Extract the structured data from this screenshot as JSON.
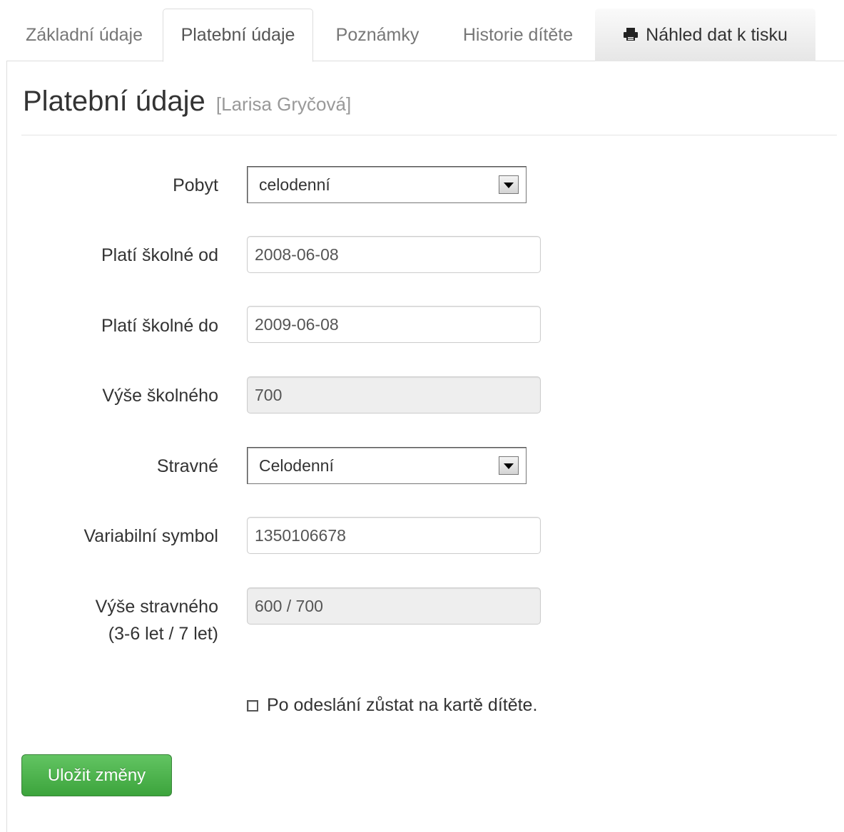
{
  "tabs": [
    {
      "label": "Základní údaje",
      "active": false
    },
    {
      "label": "Platební údaje",
      "active": true
    },
    {
      "label": "Poznámky",
      "active": false
    },
    {
      "label": "Historie dítěte",
      "active": false
    },
    {
      "label": "Náhled dat k tisku",
      "active": false,
      "icon": "printer-icon"
    }
  ],
  "page": {
    "title": "Platební údaje",
    "subtitle": "[Larisa Gryčová]"
  },
  "form": {
    "pobyt": {
      "label": "Pobyt",
      "value": "celodenní"
    },
    "plati_od": {
      "label": "Platí školné od",
      "value": "2008-06-08"
    },
    "plati_do": {
      "label": "Platí školné do",
      "value": "2009-06-08"
    },
    "vyse_skolneho": {
      "label": "Výše školného",
      "value": "700"
    },
    "stravne": {
      "label": "Stravné",
      "value": "Celodenní"
    },
    "variabilni_symbol": {
      "label": "Variabilní symbol",
      "value": "1350106678"
    },
    "vyse_stravneho": {
      "label_line1": "Výše stravného",
      "label_line2": "(3-6 let / 7 let)",
      "value": "600 / 700"
    },
    "stay_checkbox": {
      "label": "Po odeslání zůstat na kartě dítěte.",
      "checked": false
    },
    "submit_label": "Uložit změny"
  },
  "colors": {
    "submit_button": "#47a447",
    "readonly_field": "#eeeeee",
    "border": "#dddddd"
  }
}
